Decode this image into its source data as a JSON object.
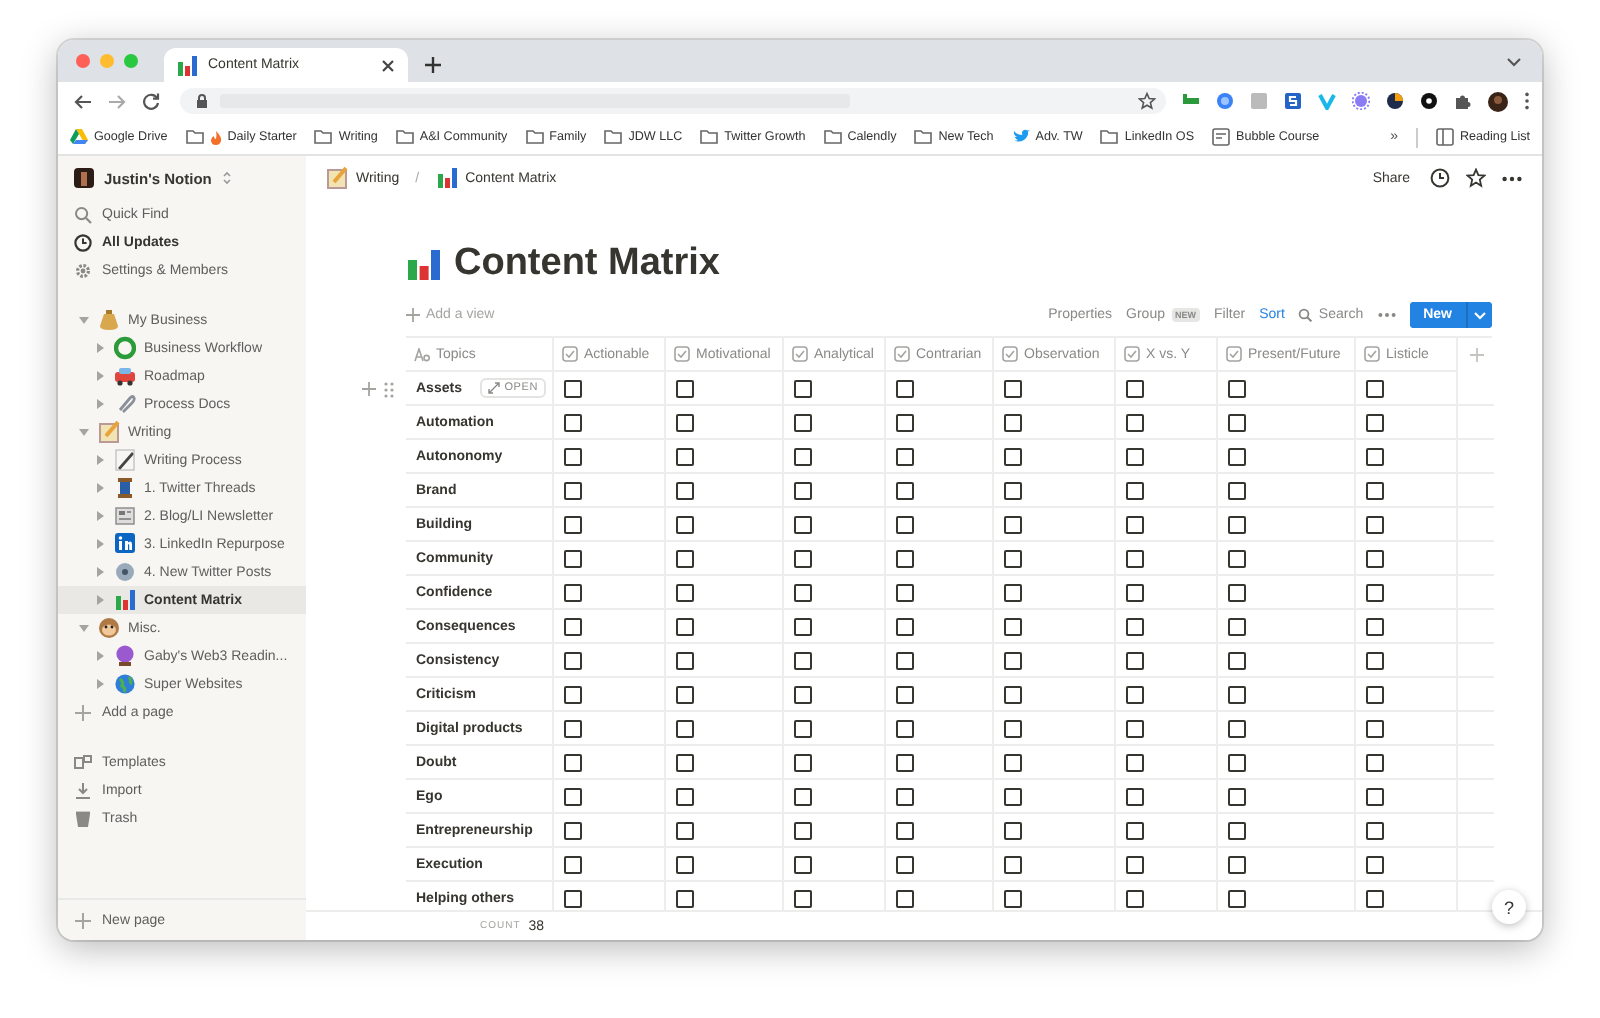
{
  "browser": {
    "tab": {
      "title": "Content Matrix",
      "selected": true
    },
    "bookmarks": [
      {
        "label": "Google Drive",
        "kind": "drive"
      },
      {
        "label": "Daily Starter",
        "kind": "folder-fire"
      },
      {
        "label": "Writing",
        "kind": "folder"
      },
      {
        "label": "A&I Community",
        "kind": "folder"
      },
      {
        "label": "Family",
        "kind": "folder"
      },
      {
        "label": "JDW LLC",
        "kind": "folder"
      },
      {
        "label": "Twitter Growth",
        "kind": "folder"
      },
      {
        "label": "Calendly",
        "kind": "folder"
      },
      {
        "label": "New Tech",
        "kind": "folder"
      },
      {
        "label": "Adv. TW",
        "kind": "bird"
      },
      {
        "label": "LinkedIn OS",
        "kind": "folder"
      },
      {
        "label": "Bubble Course",
        "kind": "page"
      }
    ],
    "overflow": "»",
    "reading_list": "Reading List"
  },
  "sidebar": {
    "workspace": "Justin's Notion",
    "menu": [
      {
        "label": "Quick Find",
        "kind": "search",
        "selected": false
      },
      {
        "label": "All Updates",
        "kind": "clock",
        "selected": true
      },
      {
        "label": "Settings & Members",
        "kind": "gear",
        "selected": false
      }
    ],
    "tree": [
      {
        "label": "My Business",
        "kind": "moneybag",
        "expanded": true,
        "selected": false,
        "children": [
          {
            "label": "Business Workflow",
            "kind": "recycle",
            "expanded": false,
            "selected": false
          },
          {
            "label": "Roadmap",
            "kind": "car",
            "expanded": false,
            "selected": false
          },
          {
            "label": "Process Docs",
            "kind": "clip",
            "expanded": false,
            "selected": false
          }
        ]
      },
      {
        "label": "Writing",
        "kind": "memo",
        "expanded": true,
        "selected": false,
        "children": [
          {
            "label": "Writing Process",
            "kind": "pen",
            "expanded": false,
            "selected": false
          },
          {
            "label": "1. Twitter Threads",
            "kind": "spool",
            "expanded": false,
            "selected": false
          },
          {
            "label": "2. Blog/LI Newsletter",
            "kind": "news",
            "expanded": false,
            "selected": false
          },
          {
            "label": "3. LinkedIn Repurpose",
            "kind": "linkedin",
            "expanded": false,
            "selected": false
          },
          {
            "label": "4. New Twitter Posts",
            "kind": "disc",
            "expanded": false,
            "selected": false
          },
          {
            "label": "Content Matrix",
            "kind": "chart",
            "expanded": false,
            "selected": true
          }
        ]
      },
      {
        "label": "Misc.",
        "kind": "monkey",
        "expanded": true,
        "selected": false,
        "children": [
          {
            "label": "Gaby's Web3 Readin...",
            "kind": "ball",
            "expanded": false,
            "selected": false
          },
          {
            "label": "Super Websites",
            "kind": "globe",
            "expanded": false,
            "selected": false
          }
        ]
      }
    ],
    "add_page": "Add a page",
    "footer": [
      {
        "label": "Templates",
        "kind": "templates"
      },
      {
        "label": "Import",
        "kind": "import"
      },
      {
        "label": "Trash",
        "kind": "trash"
      }
    ],
    "new_page": "New page"
  },
  "topbar": {
    "breadcrumb": [
      {
        "label": "Writing",
        "kind": "memo"
      },
      {
        "label": "Content Matrix",
        "kind": "chart"
      }
    ],
    "separator": "/",
    "share": "Share"
  },
  "page": {
    "title": "Content Matrix",
    "toolbar": {
      "add_view": "Add a view",
      "properties": "Properties",
      "group": "Group",
      "group_badge": "NEW",
      "filter": "Filter",
      "sort": "Sort",
      "search": "Search",
      "new": "New"
    },
    "table": {
      "columns": [
        {
          "label": "Topics",
          "kind": "title"
        },
        {
          "label": "Actionable",
          "kind": "checkbox"
        },
        {
          "label": "Motivational",
          "kind": "checkbox"
        },
        {
          "label": "Analytical",
          "kind": "checkbox"
        },
        {
          "label": "Contrarian",
          "kind": "checkbox"
        },
        {
          "label": "Observation",
          "kind": "checkbox"
        },
        {
          "label": "X vs. Y",
          "kind": "checkbox"
        },
        {
          "label": "Present/Future",
          "kind": "checkbox"
        },
        {
          "label": "Listicle",
          "kind": "checkbox"
        }
      ],
      "rows": [
        {
          "topic": "Assets",
          "open_button": "OPEN",
          "cells": [
            {
              "checked": false
            },
            {
              "checked": false
            },
            {
              "checked": false
            },
            {
              "checked": false
            },
            {
              "checked": false
            },
            {
              "checked": false
            },
            {
              "checked": false
            },
            {
              "checked": false
            }
          ]
        },
        {
          "topic": "Automation",
          "cells": [
            {
              "checked": false
            },
            {
              "checked": false
            },
            {
              "checked": false
            },
            {
              "checked": false
            },
            {
              "checked": false
            },
            {
              "checked": false
            },
            {
              "checked": false
            },
            {
              "checked": false
            }
          ]
        },
        {
          "topic": "Autononomy",
          "cells": [
            {
              "checked": false
            },
            {
              "checked": false
            },
            {
              "checked": false
            },
            {
              "checked": false
            },
            {
              "checked": false
            },
            {
              "checked": false
            },
            {
              "checked": false
            },
            {
              "checked": false
            }
          ]
        },
        {
          "topic": "Brand",
          "cells": [
            {
              "checked": false
            },
            {
              "checked": false
            },
            {
              "checked": false
            },
            {
              "checked": false
            },
            {
              "checked": false
            },
            {
              "checked": false
            },
            {
              "checked": false
            },
            {
              "checked": false
            }
          ]
        },
        {
          "topic": "Building",
          "cells": [
            {
              "checked": false
            },
            {
              "checked": false
            },
            {
              "checked": false
            },
            {
              "checked": false
            },
            {
              "checked": false
            },
            {
              "checked": false
            },
            {
              "checked": false
            },
            {
              "checked": false
            }
          ]
        },
        {
          "topic": "Community",
          "cells": [
            {
              "checked": false
            },
            {
              "checked": false
            },
            {
              "checked": false
            },
            {
              "checked": false
            },
            {
              "checked": false
            },
            {
              "checked": false
            },
            {
              "checked": false
            },
            {
              "checked": false
            }
          ]
        },
        {
          "topic": "Confidence",
          "cells": [
            {
              "checked": false
            },
            {
              "checked": false
            },
            {
              "checked": false
            },
            {
              "checked": false
            },
            {
              "checked": false
            },
            {
              "checked": false
            },
            {
              "checked": false
            },
            {
              "checked": false
            }
          ]
        },
        {
          "topic": "Consequences",
          "cells": [
            {
              "checked": false
            },
            {
              "checked": false
            },
            {
              "checked": false
            },
            {
              "checked": false
            },
            {
              "checked": false
            },
            {
              "checked": false
            },
            {
              "checked": false
            },
            {
              "checked": false
            }
          ]
        },
        {
          "topic": "Consistency",
          "cells": [
            {
              "checked": false
            },
            {
              "checked": false
            },
            {
              "checked": false
            },
            {
              "checked": false
            },
            {
              "checked": false
            },
            {
              "checked": false
            },
            {
              "checked": false
            },
            {
              "checked": false
            }
          ]
        },
        {
          "topic": "Criticism",
          "cells": [
            {
              "checked": false
            },
            {
              "checked": false
            },
            {
              "checked": false
            },
            {
              "checked": false
            },
            {
              "checked": false
            },
            {
              "checked": false
            },
            {
              "checked": false
            },
            {
              "checked": false
            }
          ]
        },
        {
          "topic": "Digital products",
          "cells": [
            {
              "checked": false
            },
            {
              "checked": false
            },
            {
              "checked": false
            },
            {
              "checked": false
            },
            {
              "checked": false
            },
            {
              "checked": false
            },
            {
              "checked": false
            },
            {
              "checked": false
            }
          ]
        },
        {
          "topic": "Doubt",
          "cells": [
            {
              "checked": false
            },
            {
              "checked": false
            },
            {
              "checked": false
            },
            {
              "checked": false
            },
            {
              "checked": false
            },
            {
              "checked": false
            },
            {
              "checked": false
            },
            {
              "checked": false
            }
          ]
        },
        {
          "topic": "Ego",
          "cells": [
            {
              "checked": false
            },
            {
              "checked": false
            },
            {
              "checked": false
            },
            {
              "checked": false
            },
            {
              "checked": false
            },
            {
              "checked": false
            },
            {
              "checked": false
            },
            {
              "checked": false
            }
          ]
        },
        {
          "topic": "Entrepreneurship",
          "cells": [
            {
              "checked": false
            },
            {
              "checked": false
            },
            {
              "checked": false
            },
            {
              "checked": false
            },
            {
              "checked": false
            },
            {
              "checked": false
            },
            {
              "checked": false
            },
            {
              "checked": false
            }
          ]
        },
        {
          "topic": "Execution",
          "cells": [
            {
              "checked": false
            },
            {
              "checked": false
            },
            {
              "checked": false
            },
            {
              "checked": false
            },
            {
              "checked": false
            },
            {
              "checked": false
            },
            {
              "checked": false
            },
            {
              "checked": false
            }
          ]
        },
        {
          "topic": "Helping others",
          "cells": [
            {
              "checked": false
            },
            {
              "checked": false
            },
            {
              "checked": false
            },
            {
              "checked": false
            },
            {
              "checked": false
            },
            {
              "checked": false
            },
            {
              "checked": false
            },
            {
              "checked": false
            }
          ]
        }
      ],
      "count_label": "COUNT",
      "count": "38"
    }
  },
  "help": "?"
}
